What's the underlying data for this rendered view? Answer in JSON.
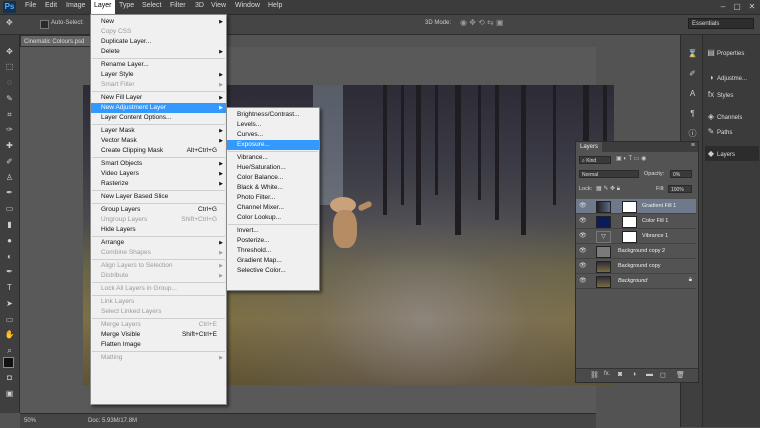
{
  "menubar": {
    "logo": "Ps",
    "items": [
      "File",
      "Edit",
      "Image",
      "Layer",
      "Type",
      "Select",
      "Filter",
      "3D",
      "View",
      "Window",
      "Help"
    ]
  },
  "options": {
    "auto_select": "Auto-Select:",
    "mode_3d": "3D Mode:"
  },
  "workspace": "Essentials",
  "document": {
    "tab": "Cinematic Colours.psd"
  },
  "status": {
    "zoom": "50%",
    "doc": "Doc: 5.93M/17.8M"
  },
  "right_dock": {
    "panels": [
      {
        "label": "Properties",
        "icon": "properties-icon"
      },
      {
        "label": "Adjustme...",
        "icon": "adjustments-icon"
      },
      {
        "label": "Styles",
        "icon": "styles-icon"
      },
      {
        "label": "Channels",
        "icon": "channels-icon"
      },
      {
        "label": "Paths",
        "icon": "paths-icon"
      },
      {
        "label": "Layers",
        "icon": "layers-icon"
      }
    ]
  },
  "layers_panel": {
    "tab": "Layers",
    "filter": "Kind",
    "blend_mode": "Normal",
    "opacity_label": "Opacity:",
    "opacity": "0%",
    "lock_label": "Lock:",
    "fill_label": "Fill:",
    "fill": "100%",
    "layers": [
      {
        "name": "Gradient Fill 1",
        "selected": true,
        "italic": false
      },
      {
        "name": "Color Fill 1",
        "selected": false,
        "italic": false
      },
      {
        "name": "Vibrance 1",
        "selected": false,
        "italic": false
      },
      {
        "name": "Background copy 2",
        "selected": false,
        "italic": false
      },
      {
        "name": "Background copy",
        "selected": false,
        "italic": false
      },
      {
        "name": "Background",
        "selected": false,
        "italic": true
      }
    ],
    "footer_icons": [
      "link-icon",
      "fx-icon",
      "mask-icon",
      "adjustment-icon",
      "folder-icon",
      "new-layer-icon",
      "trash-icon"
    ]
  },
  "layer_menu": [
    {
      "label": "New",
      "arrow": true
    },
    {
      "label": "Copy CSS",
      "disabled": true
    },
    {
      "label": "Duplicate Layer..."
    },
    {
      "label": "Delete",
      "arrow": true
    },
    {
      "sep": true
    },
    {
      "label": "Rename Layer..."
    },
    {
      "label": "Layer Style",
      "arrow": true
    },
    {
      "label": "Smart Filter",
      "disabled": true,
      "arrow": true
    },
    {
      "sep": true
    },
    {
      "label": "New Fill Layer",
      "arrow": true
    },
    {
      "label": "New Adjustment Layer",
      "arrow": true,
      "highlight": true
    },
    {
      "label": "Layer Content Options..."
    },
    {
      "sep": true
    },
    {
      "label": "Layer Mask",
      "arrow": true
    },
    {
      "label": "Vector Mask",
      "arrow": true
    },
    {
      "label": "Create Clipping Mask",
      "shortcut": "Alt+Ctrl+G"
    },
    {
      "sep": true
    },
    {
      "label": "Smart Objects",
      "arrow": true
    },
    {
      "label": "Video Layers",
      "arrow": true
    },
    {
      "label": "Rasterize",
      "arrow": true
    },
    {
      "sep": true
    },
    {
      "label": "New Layer Based Slice"
    },
    {
      "sep": true
    },
    {
      "label": "Group Layers",
      "shortcut": "Ctrl+G"
    },
    {
      "label": "Ungroup Layers",
      "shortcut": "Shift+Ctrl+G",
      "disabled": true
    },
    {
      "label": "Hide Layers"
    },
    {
      "sep": true
    },
    {
      "label": "Arrange",
      "arrow": true
    },
    {
      "label": "Combine Shapes",
      "arrow": true,
      "disabled": true
    },
    {
      "sep": true
    },
    {
      "label": "Align Layers to Selection",
      "arrow": true,
      "disabled": true
    },
    {
      "label": "Distribute",
      "arrow": true,
      "disabled": true
    },
    {
      "sep": true
    },
    {
      "label": "Lock All Layers in Group...",
      "disabled": true
    },
    {
      "sep": true
    },
    {
      "label": "Link Layers",
      "disabled": true
    },
    {
      "label": "Select Linked Layers",
      "disabled": true
    },
    {
      "sep": true
    },
    {
      "label": "Merge Layers",
      "shortcut": "Ctrl+E",
      "disabled": true
    },
    {
      "label": "Merge Visible",
      "shortcut": "Shift+Ctrl+E"
    },
    {
      "label": "Flatten Image"
    },
    {
      "sep": true
    },
    {
      "label": "Matting",
      "arrow": true,
      "disabled": true
    }
  ],
  "adjustment_submenu": [
    {
      "label": "Brightness/Contrast..."
    },
    {
      "label": "Levels..."
    },
    {
      "label": "Curves..."
    },
    {
      "label": "Exposure...",
      "highlight": true
    },
    {
      "sep": true
    },
    {
      "label": "Vibrance..."
    },
    {
      "label": "Hue/Saturation..."
    },
    {
      "label": "Color Balance..."
    },
    {
      "label": "Black & White..."
    },
    {
      "label": "Photo Filter..."
    },
    {
      "label": "Channel Mixer..."
    },
    {
      "label": "Color Lookup..."
    },
    {
      "sep": true
    },
    {
      "label": "Invert..."
    },
    {
      "label": "Posterize..."
    },
    {
      "label": "Threshold..."
    },
    {
      "label": "Gradient Map..."
    },
    {
      "label": "Selective Color..."
    }
  ]
}
